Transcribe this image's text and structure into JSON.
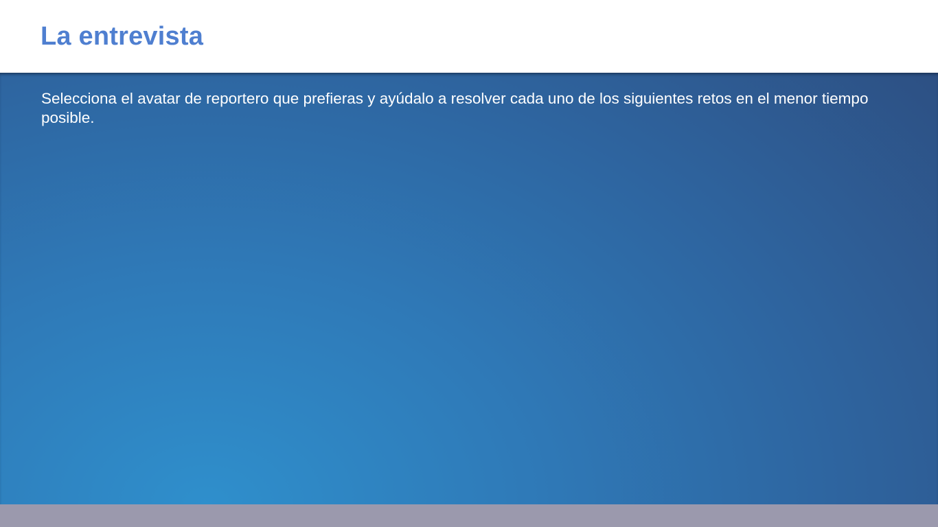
{
  "slide": {
    "title": "La entrevista",
    "body_text": "Selecciona el avatar de reportero que prefieras y ayúdalo a resolver cada uno de los siguientes retos en el menor tiempo posible."
  },
  "colors": {
    "title": "#4f7fd0",
    "content_background_light": "#2f8fcc",
    "content_background_dark": "#2d4f82",
    "footer_bar": "#9b99ad",
    "body_text": "#ffffff"
  }
}
